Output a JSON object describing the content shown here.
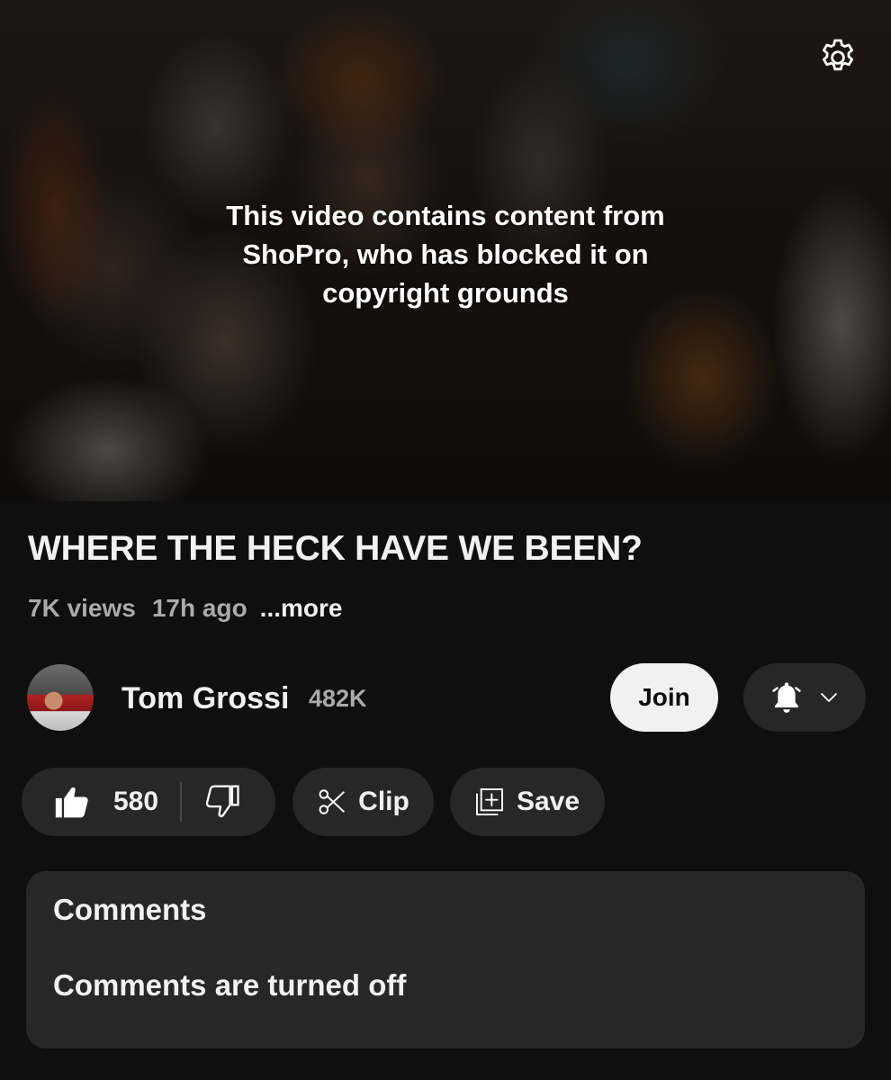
{
  "player": {
    "blocked_message_lines": [
      "This video contains content from",
      "ShoPro, who has blocked it on",
      "copyright grounds"
    ],
    "settings_icon": "gear-icon"
  },
  "video": {
    "title": "WHERE THE HECK HAVE WE BEEN?",
    "views": "7K views",
    "age": "17h ago",
    "more_label": "...more"
  },
  "channel": {
    "name": "Tom Grossi",
    "subscribers": "482K",
    "join_label": "Join",
    "subscribe_icons": [
      "bell-icon",
      "chevron-down-icon"
    ]
  },
  "actions": {
    "like_count": "580",
    "like_icon": "thumbs-up-icon",
    "dislike_icon": "thumbs-down-icon",
    "clip_label": "Clip",
    "clip_icon": "scissors-icon",
    "save_label": "Save",
    "save_icon": "add-to-playlist-icon"
  },
  "comments": {
    "heading": "Comments",
    "status": "Comments are turned off"
  },
  "colors": {
    "background": "#0f0f0f",
    "surface": "#272727",
    "text_primary": "#f1f1f1",
    "text_secondary": "#aaaaaa",
    "join_button_bg": "#f1f1f1"
  }
}
